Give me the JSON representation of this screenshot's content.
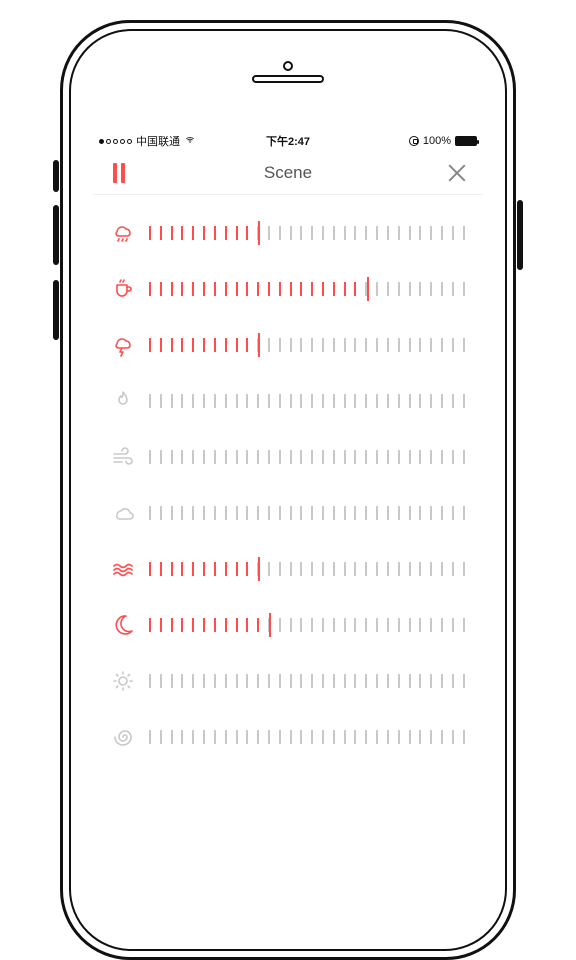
{
  "statusbar": {
    "signal_filled": 1,
    "carrier": "中国联通",
    "time": "下午2:47",
    "battery_pct": "100%"
  },
  "nav": {
    "title": "Scene"
  },
  "slider": {
    "tick_count": 30
  },
  "sounds": [
    {
      "id": "rain",
      "icon": "rain",
      "active": true,
      "value": 10
    },
    {
      "id": "coffee",
      "icon": "cup",
      "active": true,
      "value": 20
    },
    {
      "id": "thunder",
      "icon": "thunder",
      "active": true,
      "value": 10
    },
    {
      "id": "fire",
      "icon": "fire",
      "active": false,
      "value": 0
    },
    {
      "id": "wind",
      "icon": "wind",
      "active": false,
      "value": 0
    },
    {
      "id": "birds",
      "icon": "cloud2",
      "active": false,
      "value": 0
    },
    {
      "id": "waves",
      "icon": "waves",
      "active": true,
      "value": 10
    },
    {
      "id": "night",
      "icon": "moon",
      "active": true,
      "value": 11
    },
    {
      "id": "sun",
      "icon": "sun",
      "active": false,
      "value": 0
    },
    {
      "id": "spiral",
      "icon": "spiral",
      "active": false,
      "value": 0
    }
  ],
  "colors": {
    "accent": "#ff4d4d",
    "inactive": "#c8c8c8",
    "text": "#555"
  }
}
